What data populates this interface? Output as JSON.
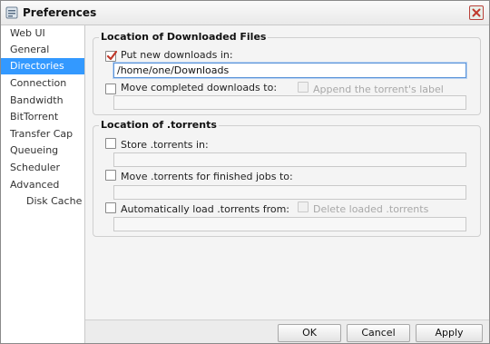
{
  "window": {
    "title": "Preferences"
  },
  "sidebar": {
    "items": [
      {
        "label": "Web UI"
      },
      {
        "label": "General"
      },
      {
        "label": "Directories",
        "selected": true
      },
      {
        "label": "Connection"
      },
      {
        "label": "Bandwidth"
      },
      {
        "label": "BitTorrent"
      },
      {
        "label": "Transfer Cap"
      },
      {
        "label": "Queueing"
      },
      {
        "label": "Scheduler"
      },
      {
        "label": "Advanced"
      },
      {
        "label": "Disk Cache"
      }
    ]
  },
  "downloaded": {
    "legend": "Location of Downloaded Files",
    "put_new": {
      "label": "Put new downloads in:",
      "checked": true,
      "value": "/home/one/Downloads"
    },
    "move_completed": {
      "label": "Move completed downloads to:",
      "checked": false,
      "value": ""
    },
    "append_label": {
      "label": "Append the torrent's label",
      "checked": false
    }
  },
  "torrents": {
    "legend": "Location of .torrents",
    "store": {
      "label": "Store .torrents in:",
      "checked": false,
      "value": ""
    },
    "move_finished": {
      "label": "Move .torrents for finished jobs to:",
      "checked": false,
      "value": ""
    },
    "auto_load": {
      "label": "Automatically load .torrents from:",
      "checked": false,
      "value": ""
    },
    "delete_loaded": {
      "label": "Delete loaded .torrents",
      "checked": false
    }
  },
  "buttons": {
    "ok": "OK",
    "cancel": "Cancel",
    "apply": "Apply"
  },
  "colors": {
    "selection": "#3399ff",
    "check_accent": "#c0392b",
    "close_icon": "#c0392b"
  }
}
